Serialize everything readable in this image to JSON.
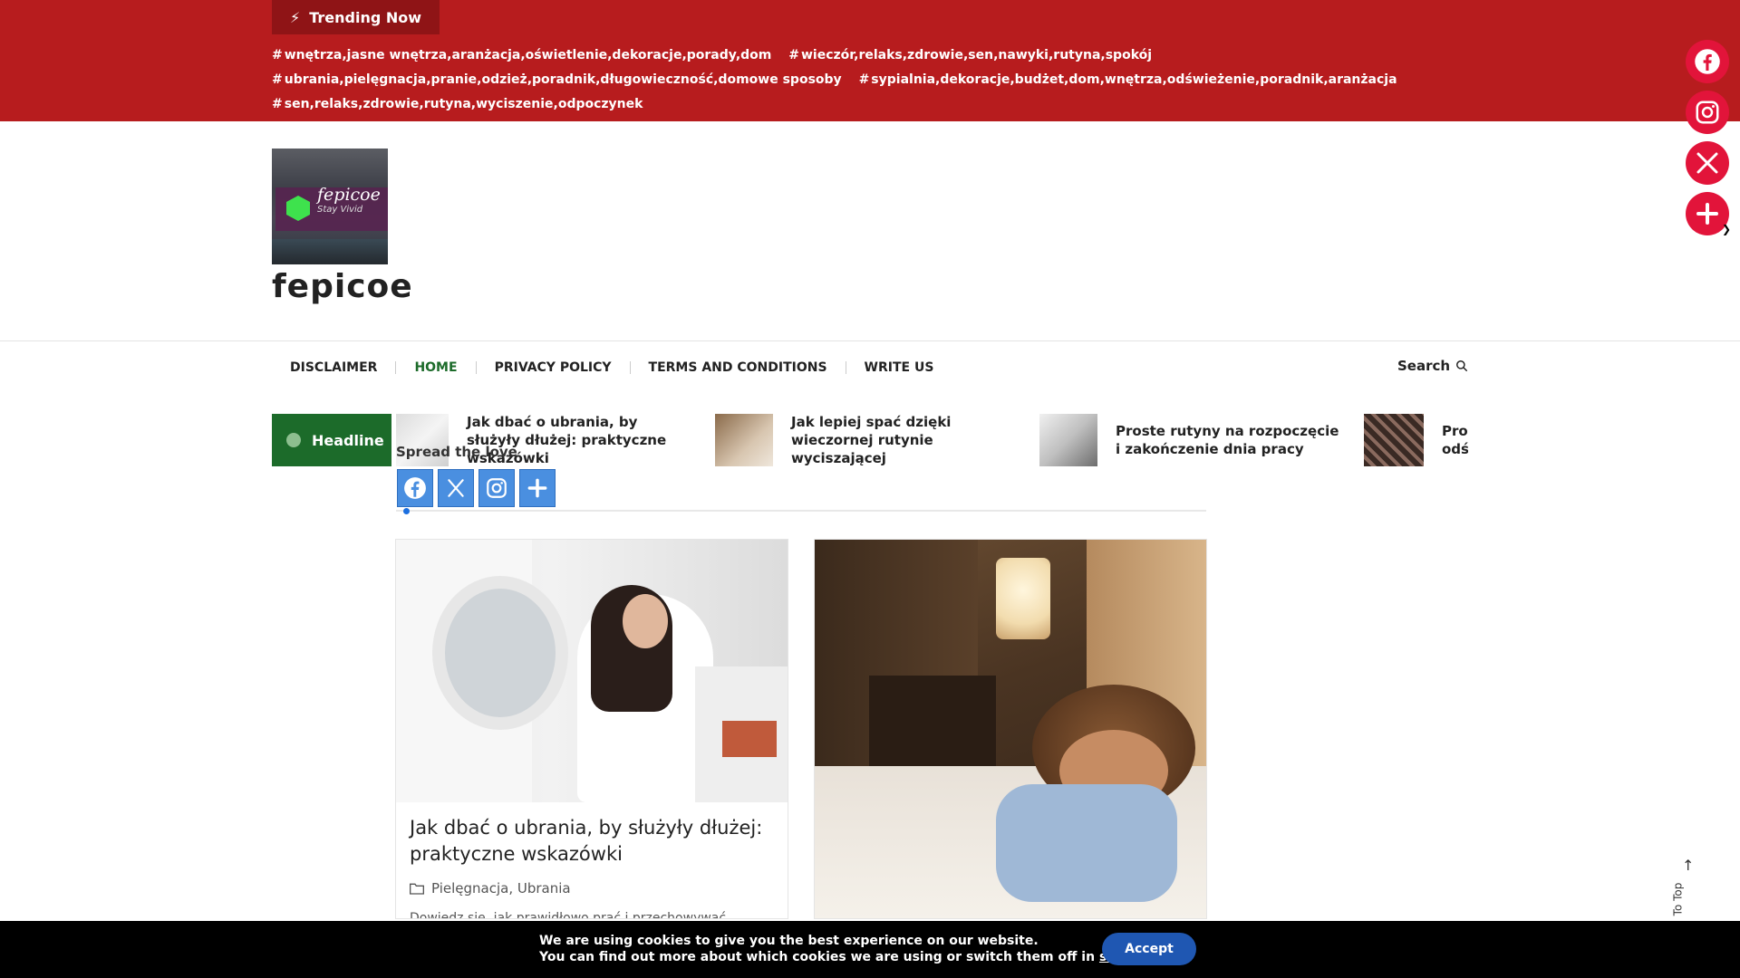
{
  "topbar": {
    "trending_label": "Trending Now",
    "tags": [
      "wnętrza,jasne wnętrza,aranżacja,oświetlenie,dekoracje,porady,dom",
      "wieczór,relaks,zdrowie,sen,nawyki,rutyna,spokój",
      "ubrania,pielęgnacja,pranie,odzież,poradnik,długowieczność,domowe sposoby",
      "sypialnia,dekoracje,budżet,dom,wnętrza,odświeżenie,poradnik,aranżacja",
      "sen,relaks,zdrowie,rutyna,wyciszenie,odpoczynek"
    ],
    "accent_color": "#b71c1e"
  },
  "social": {
    "icons": [
      "facebook-icon",
      "instagram-icon",
      "x-icon",
      "plus-icon"
    ],
    "color": "#e2143a"
  },
  "header": {
    "logo_name": "fepicoe",
    "logo_tagline": "Stay Vivid",
    "site_title": "fepicoe"
  },
  "nav": {
    "items": [
      "DISCLAIMER",
      "HOME",
      "PRIVACY POLICY",
      "TERMS AND CONDITIONS",
      "WRITE US"
    ],
    "active": "HOME",
    "search_label": "Search"
  },
  "headline": {
    "label": "Headline",
    "items": [
      "Jak dbać o ubrania, by służyły dłużej: praktyczne wskazówki",
      "Jak lepiej spać dzięki wieczornej rutynie wyciszającej",
      "Proste rutyny na rozpoczęcie i zakończenie dnia pracy",
      "Proste sposoby na odświeżenie sypialni w domu"
    ],
    "accent_color": "#1c6b2a"
  },
  "share": {
    "label": "Spread the love",
    "buttons": [
      "facebook-icon",
      "x-icon",
      "instagram-icon",
      "plus-icon"
    ]
  },
  "posts": [
    {
      "title": "Jak dbać o ubrania, by służyły dłużej: praktyczne wskazówki",
      "categories": "Pielęgnacja, Ubrania",
      "excerpt": "Dowiedz się, jak prawidłowo prać i przechowywać ubrania..."
    },
    {
      "title": "Jak lepiej spać dzięki wieczornej rutynie wyciszającej"
    }
  ],
  "totop": {
    "label": "To Top"
  },
  "cookie": {
    "line1": "We are using cookies to give you the best experience on our website.",
    "line2_prefix": "You can find out more about which cookies we are using or switch them off in ",
    "settings_link": "settings",
    "line2_suffix": ".",
    "accept_label": "Accept"
  }
}
